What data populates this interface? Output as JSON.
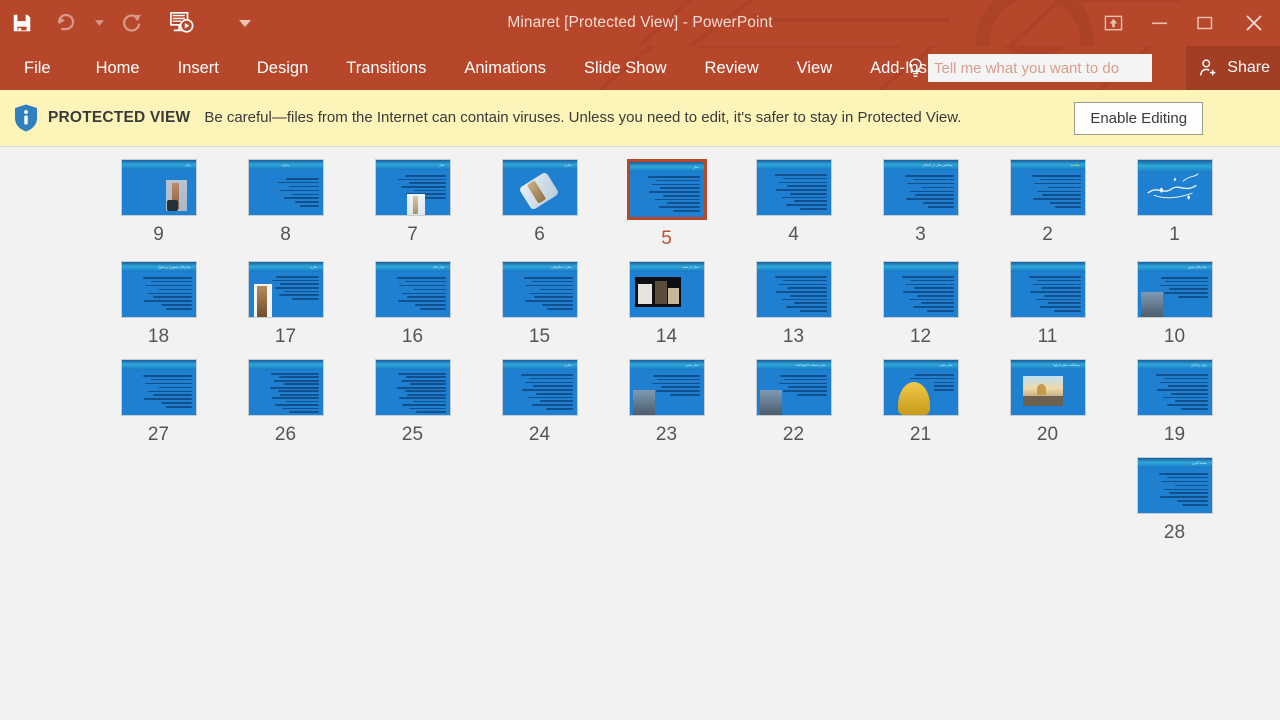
{
  "window": {
    "title": "Minaret [Protected View] - PowerPoint",
    "accent_color": "#b7472a",
    "quick_access": [
      {
        "name": "save-button",
        "icon": "save-icon",
        "enabled": true
      },
      {
        "name": "undo-button",
        "icon": "undo-icon",
        "enabled": false
      },
      {
        "name": "undo-dropdown",
        "icon": "chevron-down-icon",
        "enabled": false
      },
      {
        "name": "redo-button",
        "icon": "redo-icon",
        "enabled": false
      },
      {
        "name": "start-slideshow-button",
        "icon": "slideshow-icon",
        "enabled": true
      },
      {
        "name": "customize-qat-dropdown",
        "icon": "chevron-down-icon",
        "enabled": true
      }
    ],
    "controls": [
      {
        "name": "ribbon-display-options-button",
        "icon": "ribbon-options-icon"
      },
      {
        "name": "minimize-button",
        "icon": "minimize-icon"
      },
      {
        "name": "restore-button",
        "icon": "restore-icon"
      },
      {
        "name": "close-button",
        "icon": "close-icon"
      }
    ]
  },
  "ribbon": {
    "tabs": [
      {
        "label": "File"
      },
      {
        "label": "Home"
      },
      {
        "label": "Insert"
      },
      {
        "label": "Design"
      },
      {
        "label": "Transitions"
      },
      {
        "label": "Animations"
      },
      {
        "label": "Slide Show"
      },
      {
        "label": "Review"
      },
      {
        "label": "View"
      },
      {
        "label": "Add-Ins"
      }
    ],
    "tellme": {
      "placeholder": "Tell me what you want to do",
      "value": "",
      "icon": "lightbulb-icon"
    },
    "share": {
      "label": "Share",
      "icon": "share-person-icon"
    }
  },
  "protected_view": {
    "icon": "info-shield-icon",
    "label": "PROTECTED VIEW",
    "message": "Be careful—files from the Internet can contain viruses. Unless you need to edit, it's safer to stay in Protected View.",
    "button": "Enable Editing",
    "background_color": "#fdf4ba"
  },
  "sorter": {
    "selected_slide": 5,
    "selected_border_color": "#b7472a",
    "rows": [
      [
        {
          "number": "9",
          "kind": "photo-right",
          "title": "منار"
        },
        {
          "number": "8",
          "kind": "text-center",
          "title": "مناره"
        },
        {
          "number": "7",
          "kind": "photo-center",
          "title": "منار"
        },
        {
          "number": "6",
          "kind": "photo-tilt",
          "title": "مناره"
        },
        {
          "number": "5",
          "kind": "text-dense",
          "title": "منار",
          "selected": true
        },
        {
          "number": "4",
          "kind": "text-dense",
          "title": ""
        },
        {
          "number": "3",
          "kind": "text-bullets",
          "title": "پیدایش منار در اسلام"
        },
        {
          "number": "2",
          "kind": "text-bullets",
          "title": "مقدمه",
          "title_style": "yellow"
        },
        {
          "number": "1",
          "kind": "bismillah",
          "title": ""
        }
      ],
      [
        {
          "number": "18",
          "kind": "text-bullets",
          "title": "منارهای تیموری و مغول"
        },
        {
          "number": "17",
          "kind": "photo-left-tall",
          "title": "مناره"
        },
        {
          "number": "16",
          "kind": "text-bullets",
          "title": "منار جام"
        },
        {
          "number": "15",
          "kind": "text-bullets",
          "title": "مناره سلجوقی"
        },
        {
          "number": "14",
          "kind": "photo-wide",
          "title": "منار در شب"
        },
        {
          "number": "13",
          "kind": "text-dense",
          "title": ""
        },
        {
          "number": "12",
          "kind": "text-dense",
          "title": ""
        },
        {
          "number": "11",
          "kind": "text-dense",
          "title": ""
        },
        {
          "number": "10",
          "kind": "photo-left",
          "title": "منارهای مدور"
        }
      ],
      [
        {
          "number": "27",
          "kind": "text-bullets",
          "title": ""
        },
        {
          "number": "26",
          "kind": "text-list",
          "title": ""
        },
        {
          "number": "25",
          "kind": "text-list",
          "title": ""
        },
        {
          "number": "24",
          "kind": "text-dense",
          "title": "مناره"
        },
        {
          "number": "23",
          "kind": "photo-left",
          "title": "منار مصر"
        },
        {
          "number": "22",
          "kind": "photo-left",
          "title": "منار مسجد جامع ابیانه"
        },
        {
          "number": "21",
          "kind": "photo-cone",
          "title": "منار میلی"
        },
        {
          "number": "20",
          "kind": "photo-desert",
          "title": "مسافت میان ارچها"
        },
        {
          "number": "19",
          "kind": "text-dense",
          "title": "میل رادکان"
        }
      ],
      [
        {
          "number": "28",
          "kind": "text-bullets",
          "title": "نتیجه گیری"
        }
      ]
    ]
  }
}
